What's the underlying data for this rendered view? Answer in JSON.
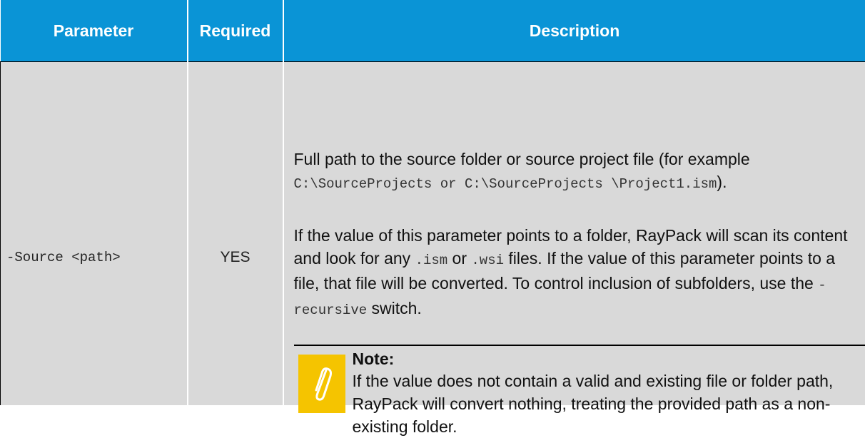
{
  "table": {
    "headers": {
      "parameter": "Parameter",
      "required": "Required",
      "description": "Description"
    },
    "row": {
      "parameter": "-Source <path>",
      "required": "YES",
      "description": {
        "p1_text1": "Full path to the source folder or source project file (for example ",
        "p1_code1": "C:\\SourceProjects",
        "p1_text2": " or ",
        "p1_code2": "C:\\SourceProjects \\Project1.ism",
        "p1_text3": ").",
        "p2_text1": "If the value of this parameter points to a folder, RayPack will scan its content and look for any ",
        "p2_code1": ".ism",
        "p2_text2": " or ",
        "p2_code2": ".wsi",
        "p2_text3": " files. If the value of this parameter points to a file, that file will be converted. To control inclusion of subfolders, use the ",
        "p2_code3": "-recursive",
        "p2_text4": " switch."
      },
      "note": {
        "icon": "paperclip-icon",
        "title": "Note:",
        "body": "If the value does not contain a valid and existing file or folder path, RayPack will convert nothing, treating the provided path as a non-existing folder."
      }
    }
  },
  "colors": {
    "header_bg": "#0a94d6",
    "cell_bg": "#d9d9d9",
    "note_icon_bg": "#f5c400"
  }
}
